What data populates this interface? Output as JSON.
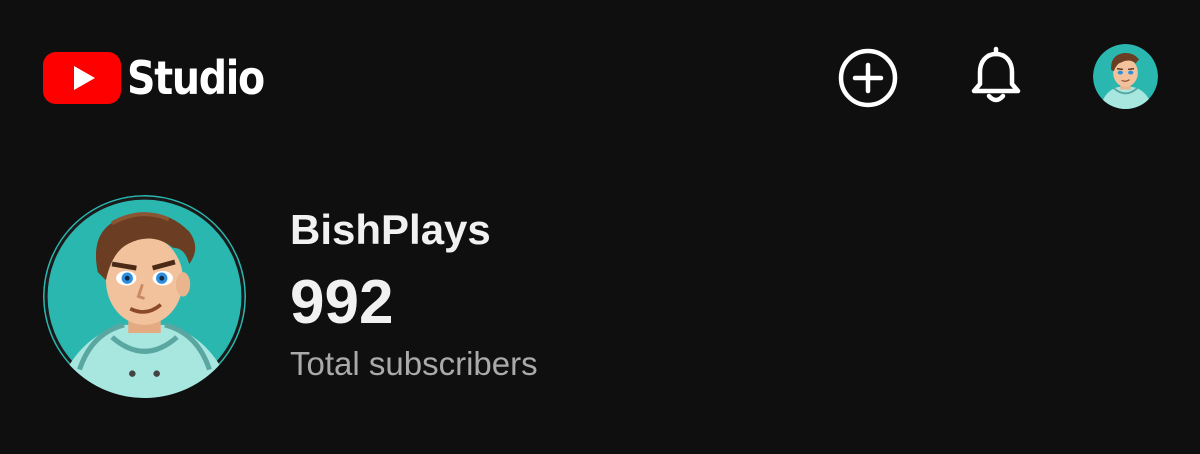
{
  "header": {
    "app_name": "Studio",
    "brand_color": "#ff0000",
    "logo_icon": "youtube-play-icon",
    "actions": [
      {
        "name": "create",
        "icon": "plus-circle-icon"
      },
      {
        "name": "notifications",
        "icon": "bell-icon"
      },
      {
        "name": "account",
        "icon": "avatar"
      }
    ]
  },
  "channel": {
    "name": "BishPlays",
    "subscriber_count": "992",
    "subscriber_label": "Total subscribers",
    "avatar_bg_color": "#2ab7b0"
  }
}
